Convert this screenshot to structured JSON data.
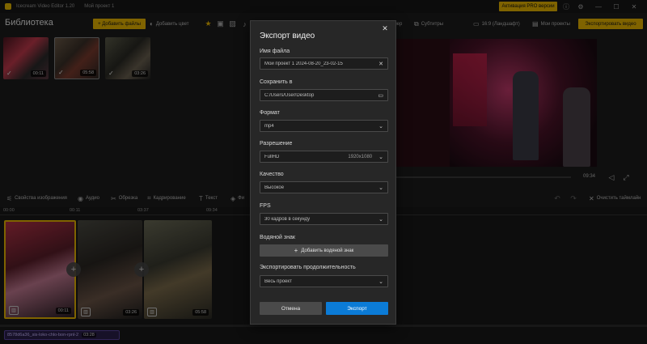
{
  "titlebar": {
    "app_name": "Icecream Video Editor 1.20",
    "project_name": "Мой проект 1",
    "pro_button": "Активация PRO версии",
    "min": "—",
    "max": "☐",
    "close": "✕",
    "settings": "⚙",
    "info": "ⓘ"
  },
  "toolbar": {
    "library_title": "Библиотека",
    "add_files": "+ Добавить файлы",
    "add_color": "Добавить цвет",
    "visor": "зер",
    "subtitles": "Субтитры",
    "aspect": "16:9 (Ландшафт)",
    "my_projects": "Мои проекты",
    "export_video": "Экспортировать видео"
  },
  "library": {
    "items": [
      {
        "duration": "00:11"
      },
      {
        "duration": "05:58"
      },
      {
        "duration": "03:26"
      }
    ]
  },
  "preview": {
    "time": "09:34"
  },
  "tools": {
    "image_props": "Свойства изображения",
    "audio": "Аудио",
    "trim": "Обрезка",
    "crop": "Кадрирование",
    "text": "Текст",
    "filters": "Фи",
    "clear_timeline": "Очистить таймлайн"
  },
  "timeline": {
    "ruler": [
      "00:00",
      "00:11",
      "03:37",
      "09:34"
    ],
    "clips": [
      {
        "duration": "00:11"
      },
      {
        "duration": "03:26"
      },
      {
        "duration": "05:58"
      }
    ],
    "audio": {
      "name": "8578d6a36_sis-loko-chlo-bon-rpnl-2",
      "time": "03:28"
    }
  },
  "dialog": {
    "title": "Экспорт видео",
    "filename_label": "Имя файла",
    "filename_value": "Мой проект 1 2024-08-20_23-02-15",
    "save_label": "Сохранить в",
    "save_value": "C:/Users/User/Desktop",
    "format_label": "Формат",
    "format_value": "mp4",
    "resolution_label": "Разрешение",
    "resolution_value": "FullHD",
    "resolution_dims": "1920x1080",
    "quality_label": "Качество",
    "quality_value": "Высокое",
    "fps_label": "FPS",
    "fps_value": "30 кадров в секунду",
    "watermark_label": "Водяной знак",
    "watermark_button": "Добавить водяной знак",
    "duration_label": "Экспортировать продолжительность",
    "duration_value": "Весь проект",
    "cancel": "Отмена",
    "export": "Экспорт"
  }
}
